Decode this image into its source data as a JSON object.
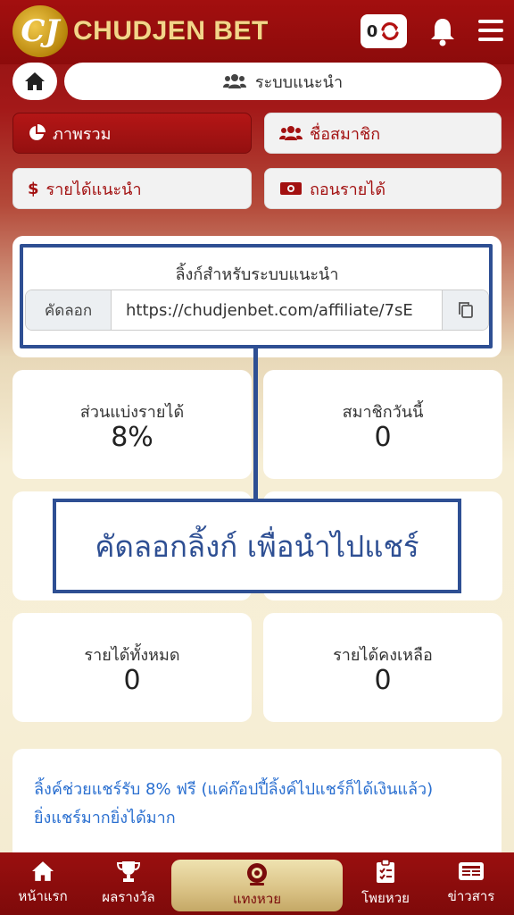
{
  "header": {
    "logo_mark": "CJ",
    "brand": "CHUDJEN BET",
    "balance": "0"
  },
  "breadcrumb": {
    "label": "ระบบแนะนำ"
  },
  "tabs": [
    {
      "label": "ภาพรวม",
      "icon": "pie-chart-icon",
      "active": true
    },
    {
      "label": "ชื่อสมาชิก",
      "icon": "users-icon",
      "active": false
    },
    {
      "label": "รายได้แนะนำ",
      "icon": "dollar-icon",
      "active": false
    },
    {
      "label": "ถอนรายได้",
      "icon": "money-bill-icon",
      "active": false
    }
  ],
  "affiliate": {
    "title": "ลิ้งก์สำหรับระบบแนะนำ",
    "copy_label": "คัดลอก",
    "link": "https://chudjenbet.com/affiliate/7sE"
  },
  "stats": {
    "share_label": "ส่วนแบ่งรายได้",
    "share_value": "8%",
    "members_today_label": "สมาชิกวันนี้",
    "members_today_value": "0",
    "total_income_label": "รายได้ทั้งหมด",
    "total_income_value": "0",
    "remaining_label": "รายได้คงเหลือ",
    "remaining_value": "0"
  },
  "callout": {
    "text": "คัดลอกลิ้งก์ เพื่อนำไปแชร์"
  },
  "info": {
    "line1": "ลิ้งค์ช่วยแชร์รับ 8% ฟรี (แค่ก๊อปปี้ลิ้งค์ไปแชร์ก็ได้เงินแล้ว)",
    "line2": "ยิ่งแชร์มากยิ่งได้มาก"
  },
  "nav": {
    "home": "หน้าแรก",
    "results": "ผลรางวัล",
    "lotto": "แทงหวย",
    "cards": "โพยหวย",
    "news": "ข่าวสาร"
  },
  "colors": {
    "brand_red": "#9a0f0f",
    "accent_blue": "#2e4f93",
    "link_blue": "#2a6fd0",
    "gold": "#d9c184"
  }
}
